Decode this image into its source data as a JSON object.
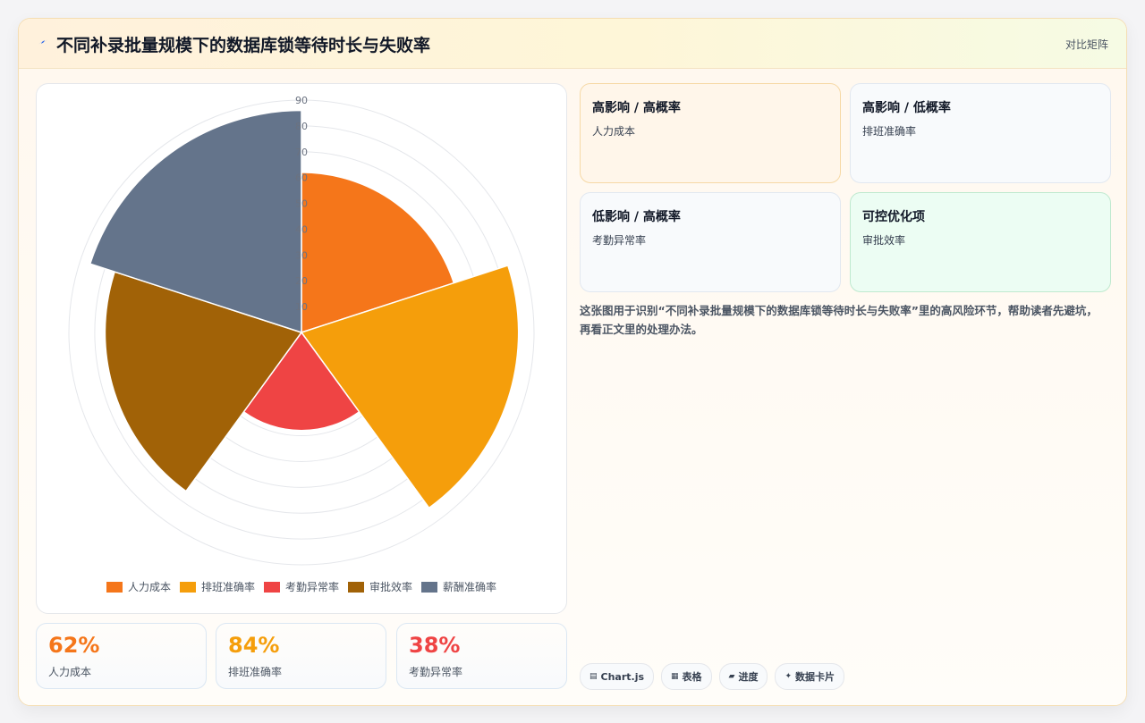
{
  "header": {
    "title": "不同补录批量规模下的数据库锁等待时长与失败率",
    "right_label": "对比矩阵"
  },
  "chart_data": {
    "type": "polarArea",
    "categories": [
      "人力成本",
      "排班准确率",
      "考勤异常率",
      "审批效率",
      "薪酬准确率"
    ],
    "values": [
      62,
      84,
      38,
      76,
      86
    ],
    "colors": [
      "#f5761a",
      "#f59e0b",
      "#ef4444",
      "#a16207",
      "#64748b"
    ],
    "rlim": [
      0,
      90
    ],
    "ticks": [
      10,
      20,
      30,
      40,
      50,
      60,
      70,
      80,
      90
    ],
    "legend_position": "bottom"
  },
  "kpis": [
    {
      "value": "62%",
      "label": "人力成本",
      "color": "#f5761a"
    },
    {
      "value": "84%",
      "label": "排班准确率",
      "color": "#f59e0b"
    },
    {
      "value": "38%",
      "label": "考勤异常率",
      "color": "#ef4444"
    }
  ],
  "matrix": [
    {
      "title": "高影响 / 高概率",
      "item": "人力成本"
    },
    {
      "title": "高影响 / 低概率",
      "item": "排班准确率"
    },
    {
      "title": "低影响 / 高概率",
      "item": "考勤异常率"
    },
    {
      "title": "可控优化项",
      "item": "审批效率"
    }
  ],
  "description": "这张图用于识别“不同补录批量规模下的数据库锁等待时长与失败率”里的高风险环节，帮助读者先避坑，再看正文里的处理办法。",
  "tags": [
    {
      "icon": "▤",
      "label": "Chart.js"
    },
    {
      "icon": "▦",
      "label": "表格"
    },
    {
      "icon": "▰",
      "label": "进度"
    },
    {
      "icon": "✦",
      "label": "数据卡片"
    }
  ]
}
